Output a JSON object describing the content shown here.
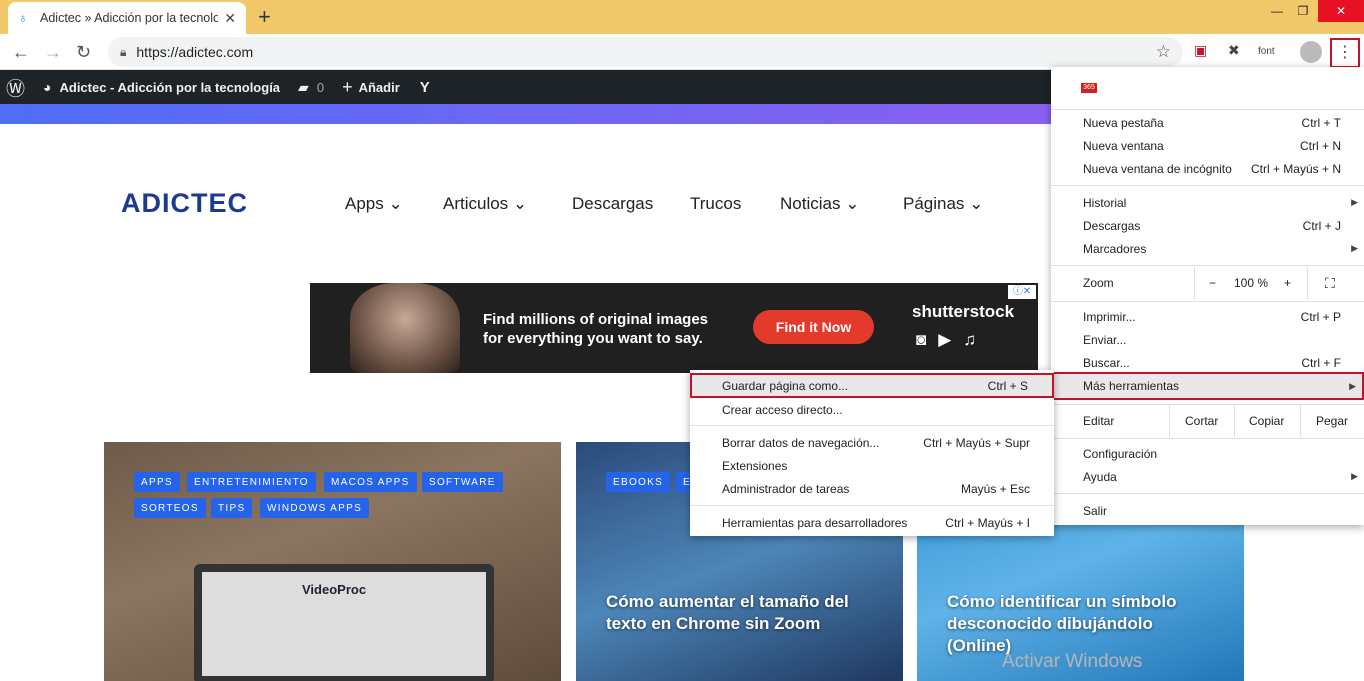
{
  "browser": {
    "tab_title": "Adictec » Adicción por la tecnolo",
    "url": "https://adictec.com",
    "ext_font_label": "font",
    "min_label": "—",
    "restore_label": "❐",
    "close_label": "✕"
  },
  "wpbar": {
    "site_name": "Adictec - Adicción por la tecnología",
    "comments_count": "0",
    "add_label": "Añadir"
  },
  "site": {
    "logo": "ADICTEC",
    "nav": [
      "Apps",
      "Articulos",
      "Descargas",
      "Trucos",
      "Noticias",
      "Páginas"
    ]
  },
  "ad": {
    "line1": "Find millions of original images",
    "line2": "for everything you want to say.",
    "cta": "Find it Now",
    "brand": "shutterstock"
  },
  "cards": {
    "card1_tags": [
      "APPS",
      "ENTRETENIMIENTO",
      "MACOS APPS",
      "SOFTWARE",
      "SORTEOS",
      "TIPS",
      "WINDOWS APPS"
    ],
    "card1_app": "VideoProc",
    "card2_tags": [
      "EBOOKS",
      "E"
    ],
    "card2_title": "Cómo aumentar el tamaño del texto en Chrome sin Zoom",
    "card3_title": "Cómo identificar un símbolo desconocido dibujándolo (Online)"
  },
  "watermark": "Activar Windows",
  "menu": {
    "badge": "365",
    "new_tab": "Nueva pestaña",
    "new_tab_sc": "Ctrl + T",
    "new_window": "Nueva ventana",
    "new_window_sc": "Ctrl + N",
    "incognito": "Nueva ventana de incógnito",
    "incognito_sc": "Ctrl + Mayús + N",
    "history": "Historial",
    "downloads": "Descargas",
    "downloads_sc": "Ctrl + J",
    "bookmarks": "Marcadores",
    "zoom": "Zoom",
    "zoom_minus": "−",
    "zoom_value": "100 %",
    "zoom_plus": "+",
    "print": "Imprimir...",
    "print_sc": "Ctrl + P",
    "send": "Enviar...",
    "find": "Buscar...",
    "find_sc": "Ctrl + F",
    "more_tools": "Más herramientas",
    "edit": "Editar",
    "cut": "Cortar",
    "copy": "Copiar",
    "paste": "Pegar",
    "settings": "Configuración",
    "help": "Ayuda",
    "exit": "Salir"
  },
  "submenu": {
    "save_page": "Guardar página como...",
    "save_page_sc": "Ctrl + S",
    "create_shortcut": "Crear acceso directo...",
    "clear_data": "Borrar datos de navegación...",
    "clear_data_sc": "Ctrl + Mayús + Supr",
    "extensions": "Extensiones",
    "task_manager": "Administrador de tareas",
    "task_manager_sc": "Mayús + Esc",
    "dev_tools": "Herramientas para desarrolladores",
    "dev_tools_sc": "Ctrl + Mayús + I"
  }
}
